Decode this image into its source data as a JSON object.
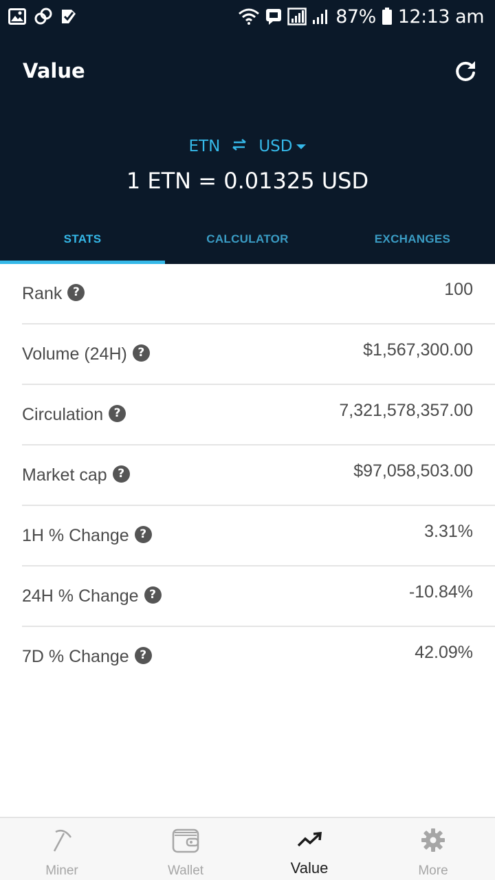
{
  "status_bar": {
    "battery": "87%",
    "time": "12:13 am",
    "left_icons": [
      "gallery-icon",
      "link-icon",
      "checklist-icon"
    ],
    "right_icons": [
      "wifi-icon",
      "message-icon",
      "signal-icon",
      "signal-icon",
      "battery-icon"
    ]
  },
  "header": {
    "title": "Value",
    "refresh_icon": "refresh-icon",
    "base_currency": "ETN",
    "quote_currency": "USD",
    "rate_text": "1 ETN = 0.01325 USD"
  },
  "tabs": [
    {
      "label": "STATS",
      "active": true
    },
    {
      "label": "CALCULATOR",
      "active": false
    },
    {
      "label": "EXCHANGES",
      "active": false
    }
  ],
  "stats": [
    {
      "label": "Rank",
      "value": "100"
    },
    {
      "label": "Volume (24H)",
      "value": "$1,567,300.00"
    },
    {
      "label": "Circulation",
      "value": "7,321,578,357.00"
    },
    {
      "label": "Market cap",
      "value": "$97,058,503.00"
    },
    {
      "label": "1H % Change",
      "value": "3.31%"
    },
    {
      "label": "24H % Change",
      "value": "-10.84%"
    },
    {
      "label": "7D % Change",
      "value": "42.09%"
    }
  ],
  "help_glyph": "?",
  "bottom_nav": [
    {
      "label": "Miner",
      "icon": "pickaxe-icon",
      "active": false
    },
    {
      "label": "Wallet",
      "icon": "wallet-icon",
      "active": false
    },
    {
      "label": "Value",
      "icon": "trending-up-icon",
      "active": true
    },
    {
      "label": "More",
      "icon": "gear-icon",
      "active": false
    }
  ],
  "colors": {
    "header_bg": "#0b1929",
    "accent": "#35b8e8",
    "text": "#4a4a4a",
    "divider": "#e4e4e4"
  }
}
